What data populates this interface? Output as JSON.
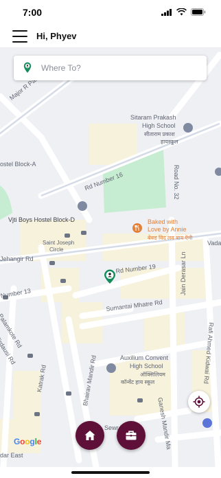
{
  "status": {
    "time": "7:00"
  },
  "header": {
    "greeting": "Hi, Phyev",
    "menu_icon": "hamburger-menu-icon"
  },
  "search": {
    "placeholder": "Where To?",
    "value": ""
  },
  "map": {
    "labels": {
      "major_rd": "Major R Paramesw",
      "sitaram_en_1": "Sitaram Prakash",
      "sitaram_en_2": "High School",
      "sitaram_hi_1": "सीताराम प्रकाश",
      "sitaram_hi_2": "हायस्कूल",
      "hostel_a": "ostel Block-A",
      "rd_16": "Rd Number 16",
      "rd_32": "Road No. 32",
      "vjti_hostel_d": "Vjti Boys Hostel Block-D",
      "baked_1": "Baked with",
      "baked_2": "Love by Annie",
      "baked_hi": "बेक्ड विद लव बाय ऍनी",
      "saint_joseph_1": "Saint Joseph",
      "saint_joseph_2": "Circle",
      "jehangir": "Jehangir Rd",
      "vada": "Vada",
      "rd_19": "Rd Number 19",
      "jain_derasar": "Jain Derasar Ln",
      "number_13": "Number 13",
      "sumantai": "Sumantai Mhatre Rd",
      "palamkote": "Palamkote Rd",
      "firdausi": "Firdausi Rd",
      "katrak": "Katrak Rd",
      "auxilium_1": "Auxilium Convent",
      "auxilium_2": "High School",
      "auxilium_hi_1": "ऑक्सिलियम",
      "auxilium_hi_2": "कॉन्वेंट हाय स्कूल",
      "rafi": "Rafi Ahmed Kidwai Rd",
      "ganesh": "Ganesh Mandir Ma",
      "bhairav": "Bhairav Mandir Rd",
      "sewri": "Sewr",
      "dar_east": "dar East"
    },
    "google_logo": {
      "G": "G",
      "o1": "o",
      "o2": "o",
      "g": "g",
      "l": "l",
      "e": "e"
    },
    "colors": {
      "road": "#ffffff",
      "road_major": "#c9d3e3",
      "park": "#c6ecd1",
      "block": "#f7f2dc",
      "accent": "#5e1038",
      "pin_green": "#148b5b",
      "poi_orange": "#e2813a"
    }
  },
  "fabs": {
    "home_icon": "home-icon",
    "bag_icon": "briefcase-icon"
  },
  "locate": {
    "icon": "my-location-icon"
  }
}
